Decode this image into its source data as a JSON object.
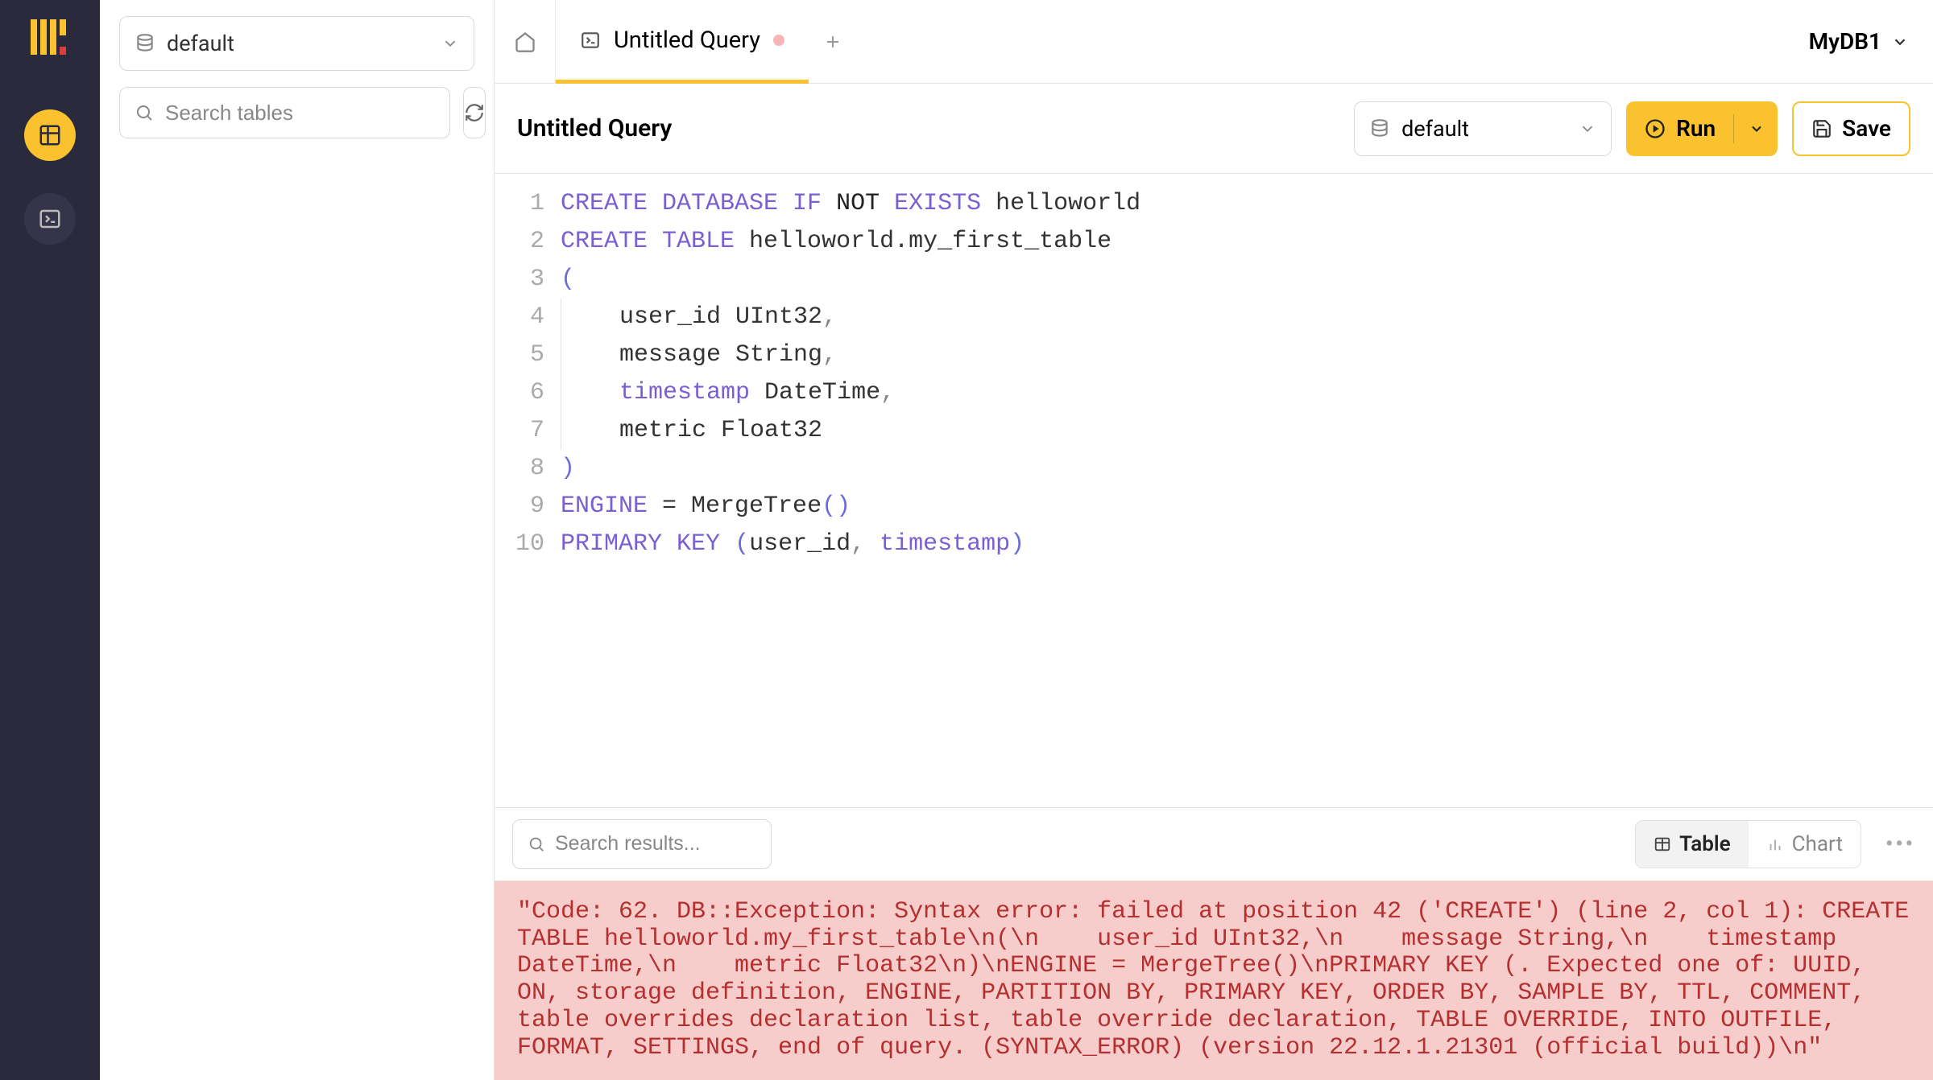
{
  "sidebar": {
    "db_selected": "default",
    "search_placeholder": "Search tables"
  },
  "tabs": {
    "active": {
      "label": "Untitled Query"
    }
  },
  "header": {
    "db_switch": "MyDB1"
  },
  "toolbar": {
    "query_title": "Untitled Query",
    "db_selected": "default",
    "run_label": "Run",
    "save_label": "Save"
  },
  "editor": {
    "lines": [
      {
        "n": "1",
        "tokens": [
          [
            "kw",
            "CREATE DATABASE IF "
          ],
          [
            "neg",
            "NOT"
          ],
          [
            "kw",
            " EXISTS"
          ],
          [
            "op",
            " helloworld"
          ]
        ]
      },
      {
        "n": "2",
        "tokens": [
          [
            "kw",
            "CREATE TABLE"
          ],
          [
            "op",
            " helloworld.my_first_table"
          ]
        ]
      },
      {
        "n": "3",
        "tokens": [
          [
            "paren",
            "("
          ]
        ]
      },
      {
        "n": "4",
        "tokens": [
          [
            "indent",
            ""
          ],
          [
            "op",
            "    user_id UInt32"
          ],
          [
            "comma",
            ","
          ]
        ]
      },
      {
        "n": "5",
        "tokens": [
          [
            "indent",
            ""
          ],
          [
            "op",
            "    message String"
          ],
          [
            "comma",
            ","
          ]
        ]
      },
      {
        "n": "6",
        "tokens": [
          [
            "indent",
            ""
          ],
          [
            "op",
            "    "
          ],
          [
            "kw",
            "timestamp"
          ],
          [
            "op",
            " DateTime"
          ],
          [
            "comma",
            ","
          ]
        ]
      },
      {
        "n": "7",
        "tokens": [
          [
            "indent",
            ""
          ],
          [
            "op",
            "    metric Float32"
          ]
        ]
      },
      {
        "n": "8",
        "tokens": [
          [
            "paren",
            ")"
          ]
        ]
      },
      {
        "n": "9",
        "tokens": [
          [
            "kw",
            "ENGINE"
          ],
          [
            "op",
            " = MergeTree"
          ],
          [
            "paren",
            "()"
          ]
        ]
      },
      {
        "n": "10",
        "tokens": [
          [
            "kw",
            "PRIMARY KEY"
          ],
          [
            "op",
            " "
          ],
          [
            "paren",
            "("
          ],
          [
            "op",
            "user_id"
          ],
          [
            "comma",
            ","
          ],
          [
            "op",
            " "
          ],
          [
            "kw",
            "timestamp"
          ],
          [
            "paren",
            ")"
          ]
        ]
      }
    ]
  },
  "results": {
    "search_placeholder": "Search results...",
    "view_table": "Table",
    "view_chart": "Chart",
    "error": "\"Code: 62. DB::Exception: Syntax error: failed at position 42 ('CREATE') (line 2, col 1): CREATE TABLE helloworld.my_first_table\\n(\\n    user_id UInt32,\\n    message String,\\n    timestamp DateTime,\\n    metric Float32\\n)\\nENGINE = MergeTree()\\nPRIMARY KEY (. Expected one of: UUID, ON, storage definition, ENGINE, PARTITION BY, PRIMARY KEY, ORDER BY, SAMPLE BY, TTL, COMMENT, table overrides declaration list, table override declaration, TABLE OVERRIDE, INTO OUTFILE, FORMAT, SETTINGS, end of query. (SYNTAX_ERROR) (version 22.12.1.21301 (official build))\\n\""
  }
}
